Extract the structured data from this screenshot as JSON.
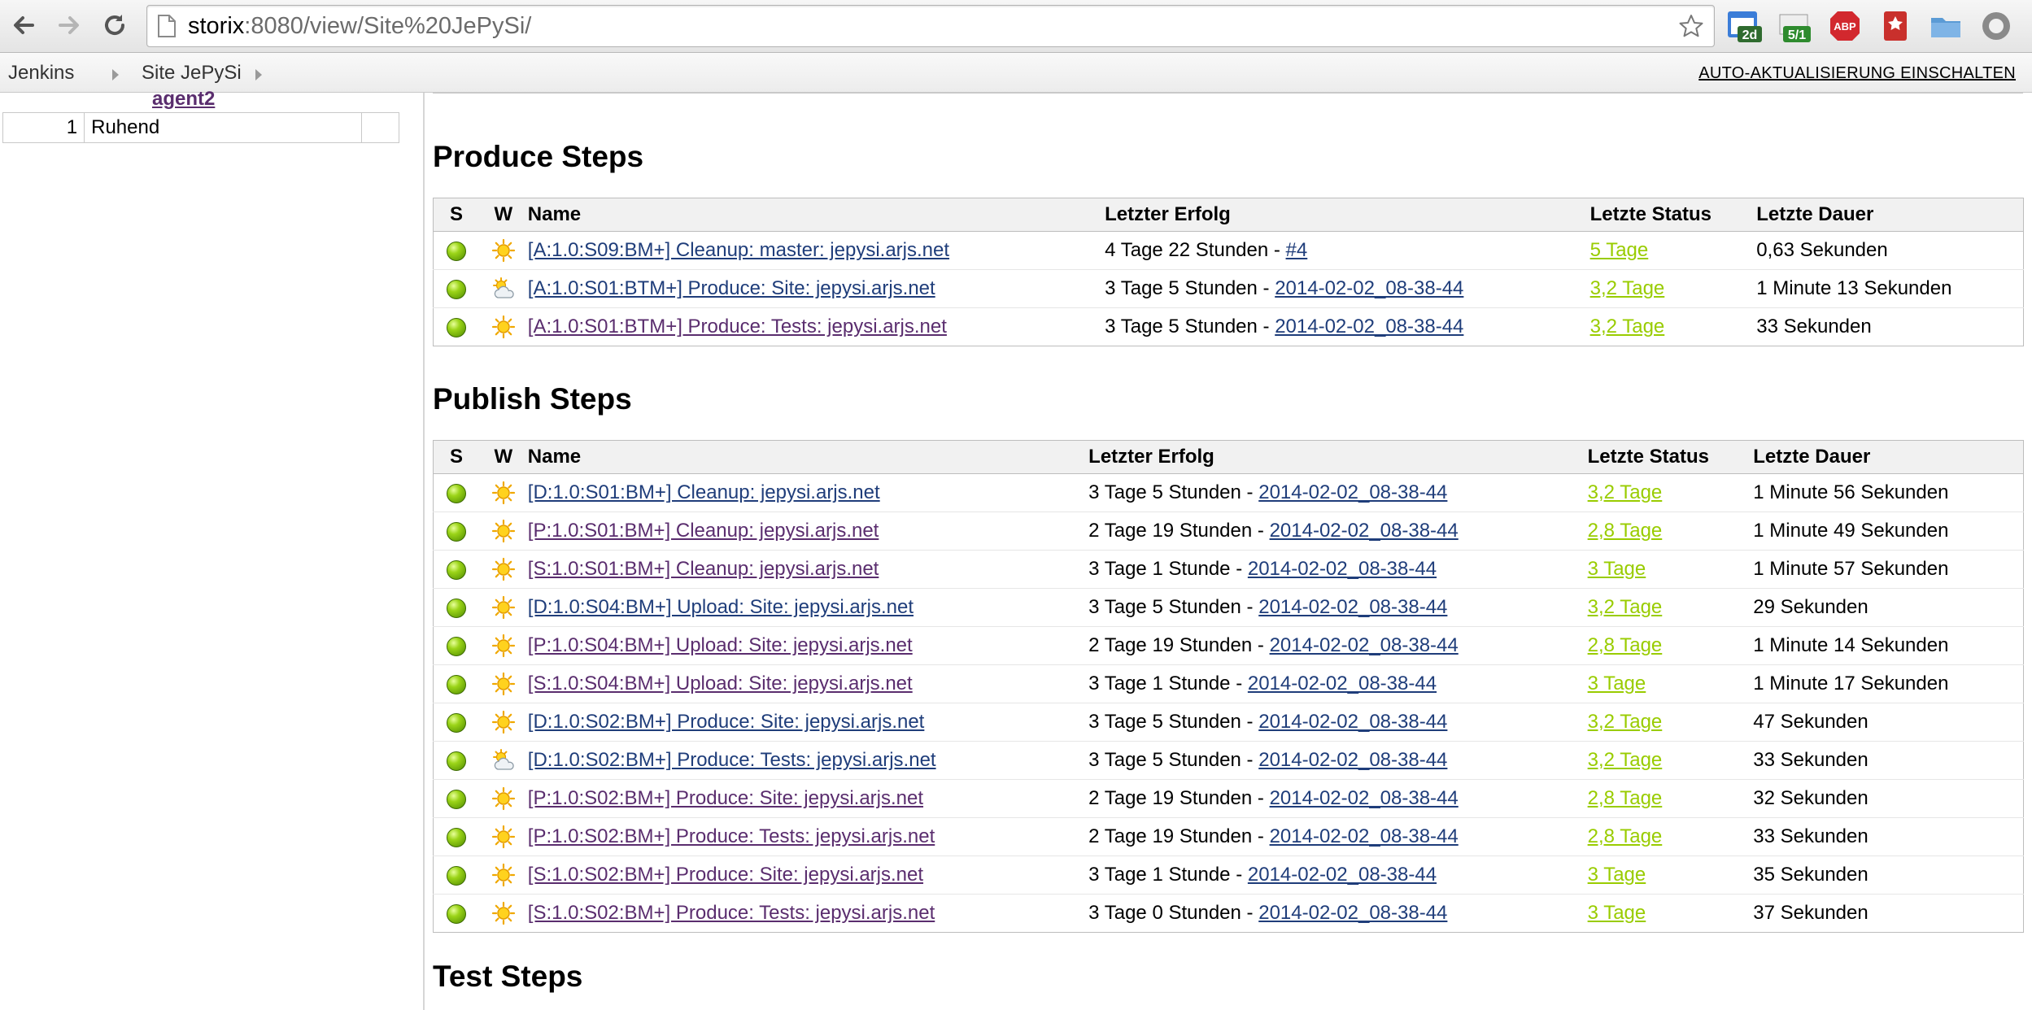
{
  "browser": {
    "url_host": "storix",
    "url_rest": ":8080/view/Site%20JePySi/",
    "ext_badges": [
      "2d",
      "5/1"
    ],
    "abp_label": "ABP"
  },
  "breadcrumb": {
    "items": [
      "Jenkins",
      "Site JePySi"
    ],
    "auto_refresh": "AUTO-AKTUALISIERUNG EINSCHALTEN"
  },
  "sidebar": {
    "agent_name": "agent2",
    "executors": [
      {
        "number": "1",
        "status": "Ruhend"
      }
    ]
  },
  "columns": {
    "s": "S",
    "w": "W",
    "name": "Name",
    "last_success": "Letzter Erfolg",
    "last_status": "Letzte Status",
    "last_duration": "Letzte Dauer"
  },
  "sections": [
    {
      "title": "Produce Steps",
      "rows": [
        {
          "name": "[A:1.0:S09:BM+] Cleanup: master: jepysi.arjs.net",
          "weather": "sunny",
          "visited": false,
          "success_text": "4 Tage 22 Stunden - ",
          "build": "#4",
          "status": "5 Tage",
          "duration": "0,63 Sekunden"
        },
        {
          "name": "[A:1.0:S01:BTM+] Produce: Site: jepysi.arjs.net",
          "weather": "cloudy",
          "visited": false,
          "success_text": "3 Tage 5 Stunden - ",
          "build": "2014-02-02_08-38-44",
          "status": "3,2 Tage",
          "duration": "1 Minute 13 Sekunden"
        },
        {
          "name": "[A:1.0:S01:BTM+] Produce: Tests: jepysi.arjs.net",
          "weather": "sunny",
          "visited": true,
          "success_text": "3 Tage 5 Stunden - ",
          "build": "2014-02-02_08-38-44",
          "status": "3,2 Tage",
          "duration": "33 Sekunden"
        }
      ]
    },
    {
      "title": "Publish Steps",
      "rows": [
        {
          "name": "[D:1.0:S01:BM+] Cleanup: jepysi.arjs.net",
          "weather": "sunny",
          "visited": false,
          "success_text": "3 Tage 5 Stunden - ",
          "build": "2014-02-02_08-38-44",
          "status": "3,2 Tage",
          "duration": "1 Minute 56 Sekunden"
        },
        {
          "name": "[P:1.0:S01:BM+] Cleanup: jepysi.arjs.net",
          "weather": "sunny",
          "visited": true,
          "success_text": "2 Tage 19 Stunden - ",
          "build": "2014-02-02_08-38-44",
          "status": "2,8 Tage",
          "duration": "1 Minute 49 Sekunden"
        },
        {
          "name": "[S:1.0:S01:BM+] Cleanup: jepysi.arjs.net",
          "weather": "sunny",
          "visited": true,
          "success_text": "3 Tage 1 Stunde - ",
          "build": "2014-02-02_08-38-44",
          "status": "3 Tage",
          "duration": "1 Minute 57 Sekunden"
        },
        {
          "name": "[D:1.0:S04:BM+] Upload: Site: jepysi.arjs.net",
          "weather": "sunny",
          "visited": false,
          "success_text": "3 Tage 5 Stunden - ",
          "build": "2014-02-02_08-38-44",
          "status": "3,2 Tage",
          "duration": "29 Sekunden"
        },
        {
          "name": "[P:1.0:S04:BM+] Upload: Site: jepysi.arjs.net",
          "weather": "sunny",
          "visited": true,
          "success_text": "2 Tage 19 Stunden - ",
          "build": "2014-02-02_08-38-44",
          "status": "2,8 Tage",
          "duration": "1 Minute 14 Sekunden"
        },
        {
          "name": "[S:1.0:S04:BM+] Upload: Site: jepysi.arjs.net",
          "weather": "sunny",
          "visited": true,
          "success_text": "3 Tage 1 Stunde - ",
          "build": "2014-02-02_08-38-44",
          "status": "3 Tage",
          "duration": "1 Minute 17 Sekunden"
        },
        {
          "name": "[D:1.0:S02:BM+] Produce: Site: jepysi.arjs.net",
          "weather": "sunny",
          "visited": false,
          "success_text": "3 Tage 5 Stunden - ",
          "build": "2014-02-02_08-38-44",
          "status": "3,2 Tage",
          "duration": "47 Sekunden"
        },
        {
          "name": "[D:1.0:S02:BM+] Produce: Tests: jepysi.arjs.net",
          "weather": "cloudy",
          "visited": false,
          "success_text": "3 Tage 5 Stunden - ",
          "build": "2014-02-02_08-38-44",
          "status": "3,2 Tage",
          "duration": "33 Sekunden"
        },
        {
          "name": "[P:1.0:S02:BM+] Produce: Site: jepysi.arjs.net",
          "weather": "sunny",
          "visited": true,
          "success_text": "2 Tage 19 Stunden - ",
          "build": "2014-02-02_08-38-44",
          "status": "2,8 Tage",
          "duration": "32 Sekunden"
        },
        {
          "name": "[P:1.0:S02:BM+] Produce: Tests: jepysi.arjs.net",
          "weather": "sunny",
          "visited": true,
          "success_text": "2 Tage 19 Stunden - ",
          "build": "2014-02-02_08-38-44",
          "status": "2,8 Tage",
          "duration": "33 Sekunden"
        },
        {
          "name": "[S:1.0:S02:BM+] Produce: Site: jepysi.arjs.net",
          "weather": "sunny",
          "visited": true,
          "success_text": "3 Tage 1 Stunde - ",
          "build": "2014-02-02_08-38-44",
          "status": "3 Tage",
          "duration": "35 Sekunden"
        },
        {
          "name": "[S:1.0:S02:BM+] Produce: Tests: jepysi.arjs.net",
          "weather": "sunny",
          "visited": true,
          "success_text": "3 Tage 0 Stunden - ",
          "build": "2014-02-02_08-38-44",
          "status": "3 Tage",
          "duration": "37 Sekunden"
        }
      ]
    },
    {
      "title": "Test Steps",
      "rows": []
    }
  ]
}
